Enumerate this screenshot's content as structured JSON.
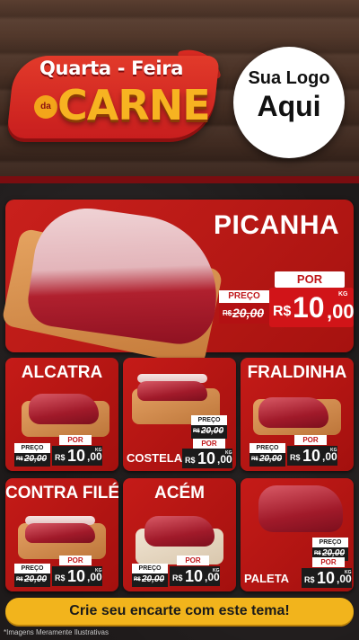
{
  "header": {
    "logo_line1": "Quarta - Feira",
    "logo_da": "da",
    "logo_line2": "CARNE",
    "brand_line1": "Sua Logo",
    "brand_line2": "Aqui"
  },
  "featured": {
    "name": "PICANHA",
    "old_label": "PREÇO",
    "old_currency": "R$",
    "old_value": "20,00",
    "new_label": "POR",
    "currency": "R$",
    "price_int": "10",
    "price_dec": ",00",
    "unit": "KG"
  },
  "products": [
    {
      "name": "ALCATRA",
      "old_label": "PREÇO",
      "old_currency": "R$",
      "old_value": "20,00",
      "new_label": "POR",
      "currency": "R$",
      "price_int": "10",
      "price_dec": ",00",
      "unit": "KG"
    },
    {
      "name": "COSTELA",
      "old_label": "PREÇO",
      "old_currency": "R$",
      "old_value": "20,00",
      "new_label": "POR",
      "currency": "R$",
      "price_int": "10",
      "price_dec": ",00",
      "unit": "KG"
    },
    {
      "name": "FRALDINHA",
      "old_label": "PREÇO",
      "old_currency": "R$",
      "old_value": "20,00",
      "new_label": "POR",
      "currency": "R$",
      "price_int": "10",
      "price_dec": ",00",
      "unit": "KG"
    },
    {
      "name": "CONTRA FILÉ",
      "old_label": "PREÇO",
      "old_currency": "R$",
      "old_value": "20,00",
      "new_label": "POR",
      "currency": "R$",
      "price_int": "10",
      "price_dec": ",00",
      "unit": "KG"
    },
    {
      "name": "ACÉM",
      "old_label": "PREÇO",
      "old_currency": "R$",
      "old_value": "20,00",
      "new_label": "POR",
      "currency": "R$",
      "price_int": "10",
      "price_dec": ",00",
      "unit": "KG"
    },
    {
      "name": "PALETA",
      "old_label": "PREÇO",
      "old_currency": "R$",
      "old_value": "20,00",
      "new_label": "POR",
      "currency": "R$",
      "price_int": "10",
      "price_dec": ",00",
      "unit": "KG"
    }
  ],
  "banner": {
    "text": "Crie seu encarte com este tema!"
  },
  "footer": {
    "note": "*Imagens Meramente Ilustrativas"
  },
  "colors": {
    "primary_red": "#c51b18",
    "accent_yellow": "#f2b41c",
    "board_dark": "#1e1a1a"
  }
}
